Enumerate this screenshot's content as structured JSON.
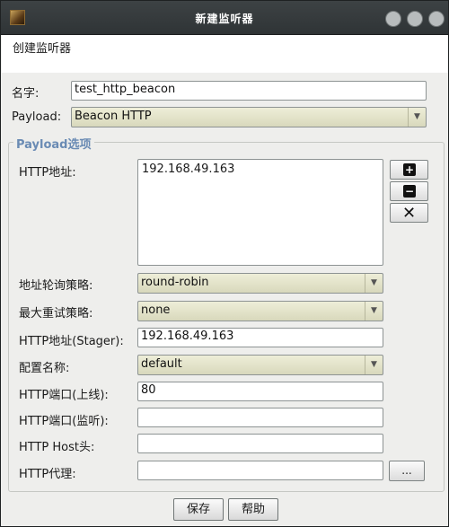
{
  "window": {
    "title": "新建监听器"
  },
  "header": {
    "text": "创建监听器"
  },
  "form": {
    "name": {
      "label": "名字:",
      "value": "test_http_beacon"
    },
    "payload": {
      "label": "Payload:",
      "value": "Beacon HTTP"
    }
  },
  "group": {
    "title": "Payload选项",
    "http_hosts": {
      "label": "HTTP地址:",
      "lines": [
        "192.168.49.163"
      ]
    },
    "rotation": {
      "label": "地址轮询策略:",
      "value": "round-robin"
    },
    "max_retry": {
      "label": "最大重试策略:",
      "value": "none"
    },
    "stager_host": {
      "label": "HTTP地址(Stager):",
      "value": "192.168.49.163"
    },
    "profile": {
      "label": "配置名称:",
      "value": "default"
    },
    "port_c2": {
      "label": "HTTP端口(上线):",
      "value": "80"
    },
    "port_bind": {
      "label": "HTTP端口(监听):",
      "value": ""
    },
    "host_header": {
      "label": "HTTP Host头:",
      "value": ""
    },
    "proxy": {
      "label": "HTTP代理:",
      "value": "",
      "button": "..."
    }
  },
  "buttons": {
    "save": "保存",
    "help": "帮助"
  },
  "icons": {
    "add": "plus-icon",
    "remove": "minus-icon",
    "clear": "x-icon",
    "dropdown": "chevron-down-icon"
  },
  "colors": {
    "group_title": "#6a8bb4",
    "combo_bg": "#e4e4cc"
  }
}
